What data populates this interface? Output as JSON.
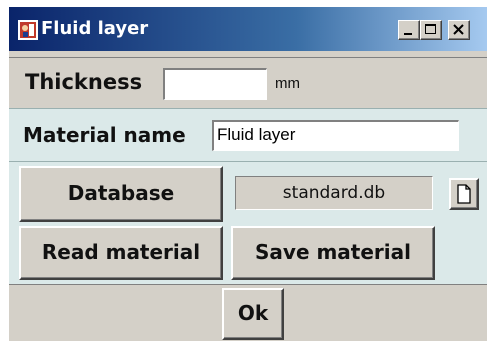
{
  "window": {
    "title": "Fluid layer",
    "icon": "application-icon",
    "controls": {
      "minimize": "minimize-icon",
      "maximize": "maximize-icon",
      "close": "close-icon"
    }
  },
  "thickness": {
    "label": "Thickness",
    "value": "",
    "unit": "mm"
  },
  "material": {
    "label": "Material name",
    "value": "Fluid layer"
  },
  "database": {
    "button_label": "Database",
    "file": "standard.db",
    "file_icon": "document-icon"
  },
  "actions": {
    "read_label": "Read material",
    "save_label": "Save material"
  },
  "footer": {
    "ok_label": "Ok"
  },
  "colors": {
    "titlebar_start": "#0a246a",
    "titlebar_end": "#a6caf0",
    "panel": "#d4d0c8",
    "panel_light": "#dbe9e9"
  }
}
